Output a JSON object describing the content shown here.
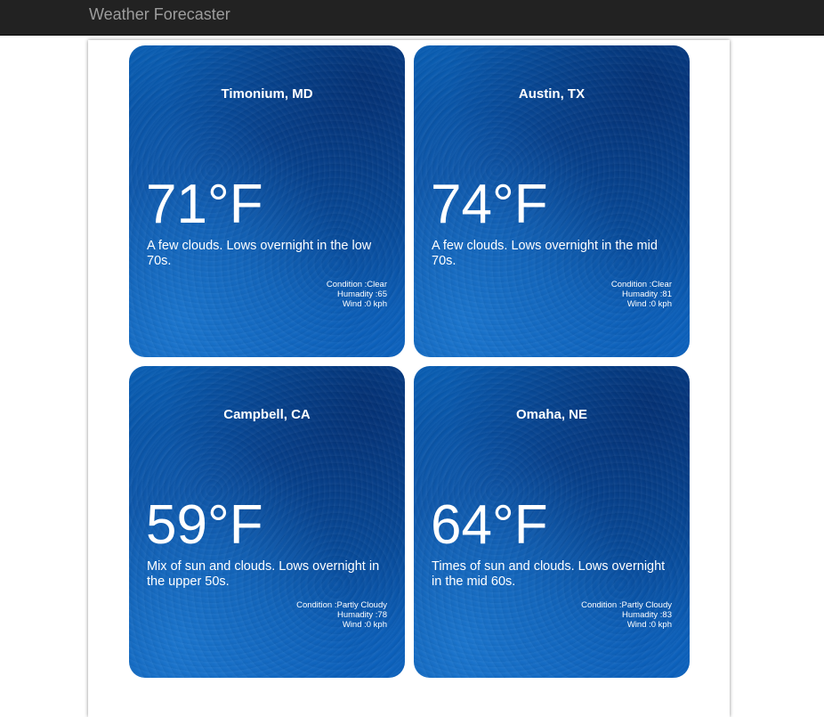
{
  "navbar": {
    "brand": "Weather Forecaster"
  },
  "cards": [
    {
      "city": "Timonium, MD",
      "temperature": "71°F",
      "description": "A few clouds. Lows overnight in the low 70s.",
      "condition": "Condition :Clear",
      "humidity": "Humadity :65",
      "wind": "Wind :0 kph"
    },
    {
      "city": "Austin, TX",
      "temperature": "74°F",
      "description": "A few clouds. Lows overnight in the mid 70s.",
      "condition": "Condition :Clear",
      "humidity": "Humadity :81",
      "wind": "Wind :0 kph"
    },
    {
      "city": "Campbell, CA",
      "temperature": "59°F",
      "description": "Mix of sun and clouds. Lows overnight in the upper 50s.",
      "condition": "Condition :Partly Cloudy",
      "humidity": "Humadity :78",
      "wind": "Wind :0 kph"
    },
    {
      "city": "Omaha, NE",
      "temperature": "64°F",
      "description": "Times of sun and clouds. Lows overnight in the mid 60s.",
      "condition": "Condition :Partly Cloudy",
      "humidity": "Humadity :83",
      "wind": "Wind :0 kph"
    }
  ],
  "colors": {
    "navbar_bg": "#222222",
    "brand_text": "#9d9d9d",
    "card_blue": "#0a56aa",
    "card_text": "#ffffff"
  }
}
